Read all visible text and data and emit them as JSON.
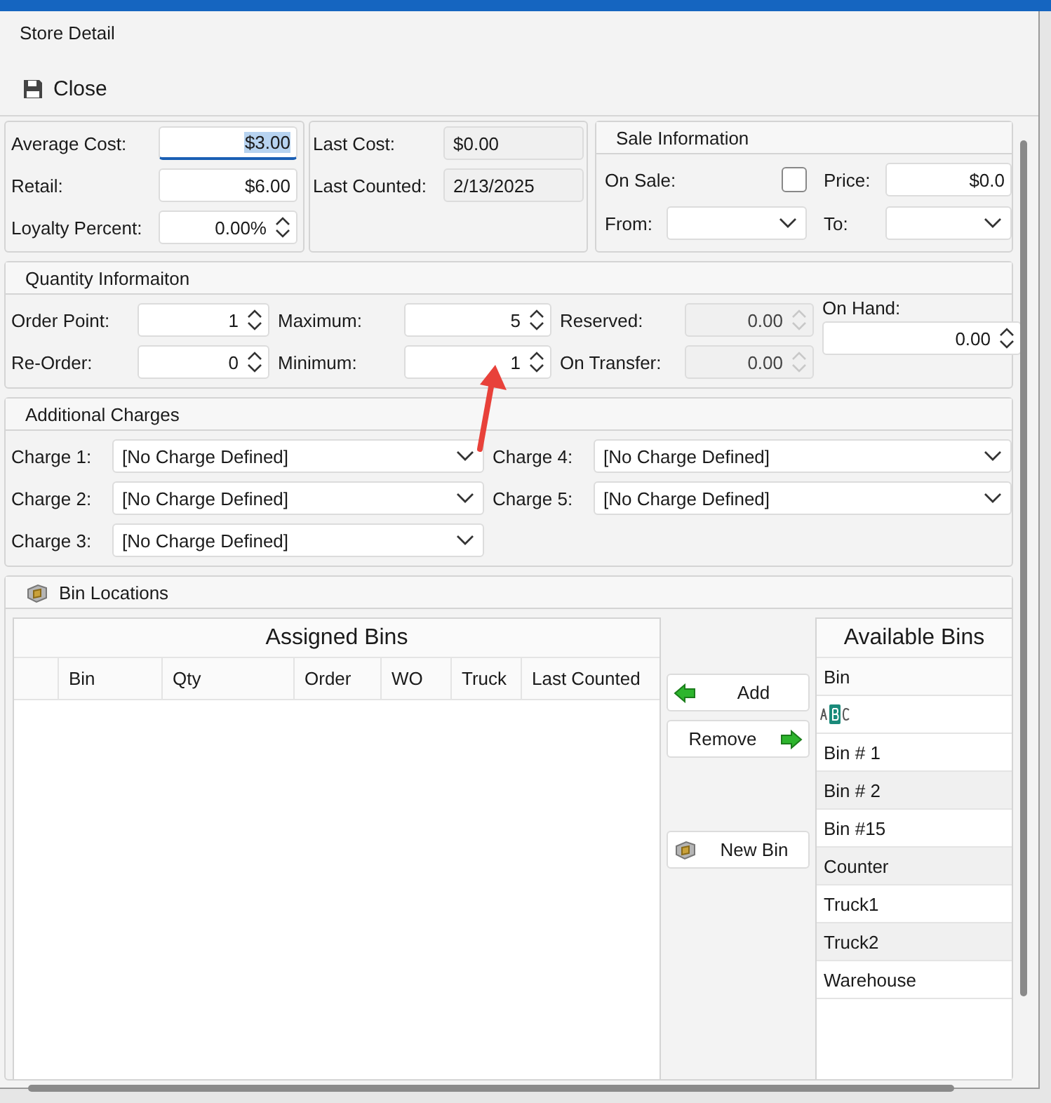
{
  "dialog": {
    "title": "Store Detail"
  },
  "toolbar": [
    {
      "label": "Close"
    }
  ],
  "cost_panel": {
    "fields": [
      {
        "label": "Average Cost:",
        "value": "$3.00",
        "kind": "text",
        "focused": true
      },
      {
        "label": "Retail:",
        "value": "$6.00",
        "kind": "text",
        "focused": false
      },
      {
        "label": "Loyalty Percent:",
        "value": "0.00%",
        "kind": "spin",
        "focused": false
      }
    ]
  },
  "history_panel": {
    "fields": [
      {
        "label": "Last Cost:",
        "value": "$0.00"
      },
      {
        "label": "Last Counted:",
        "value": "2/13/2025"
      }
    ]
  },
  "sale_panel": {
    "title": "Sale Information",
    "on_sale": {
      "label": "On Sale:",
      "checked": false
    },
    "price": {
      "label": "Price:",
      "value": "$0.0"
    },
    "from": {
      "label": "From:"
    },
    "to": {
      "label": "To:"
    }
  },
  "quantity": {
    "title": "Quantity Informaiton",
    "columns": [
      {
        "fields": [
          {
            "label": "Order Point:",
            "value": "1",
            "disabled": false
          },
          {
            "label": "Re-Order:",
            "value": "0",
            "disabled": false
          }
        ]
      },
      {
        "fields": [
          {
            "label": "Maximum:",
            "value": "5",
            "disabled": false
          },
          {
            "label": "Minimum:",
            "value": "1",
            "disabled": false
          }
        ]
      },
      {
        "fields": [
          {
            "label": "Reserved:",
            "value": "0.00",
            "disabled": true
          },
          {
            "label": "On Transfer:",
            "value": "0.00",
            "disabled": true
          }
        ]
      }
    ],
    "on_hand": {
      "label": "On Hand:",
      "value": "0.00",
      "disabled": false
    }
  },
  "charges": {
    "title": "Additional Charges",
    "items": [
      {
        "label": "Charge 1:",
        "value": "[No Charge Defined]"
      },
      {
        "label": "Charge 2:",
        "value": "[No Charge Defined]"
      },
      {
        "label": "Charge 3:",
        "value": "[No Charge Defined]"
      },
      {
        "label": "Charge 4:",
        "value": "[No Charge Defined]"
      },
      {
        "label": "Charge 5:",
        "value": "[No Charge Defined]"
      }
    ]
  },
  "bins": {
    "title": "Bin Locations",
    "assigned": {
      "title": "Assigned Bins",
      "columns": [
        "Bin",
        "Qty",
        "Order",
        "WO",
        "Truck",
        "Last Counted"
      ]
    },
    "buttons": [
      {
        "label": "Add",
        "kind": "add"
      },
      {
        "label": "Remove",
        "kind": "remove"
      },
      {
        "label": "New Bin",
        "kind": "new"
      }
    ],
    "available": {
      "title": "Available Bins",
      "column": "Bin",
      "rows": [
        "Bin # 1",
        "Bin # 2",
        "Bin #15",
        "Counter",
        "Truck1",
        "Truck2",
        "Warehouse"
      ]
    }
  }
}
